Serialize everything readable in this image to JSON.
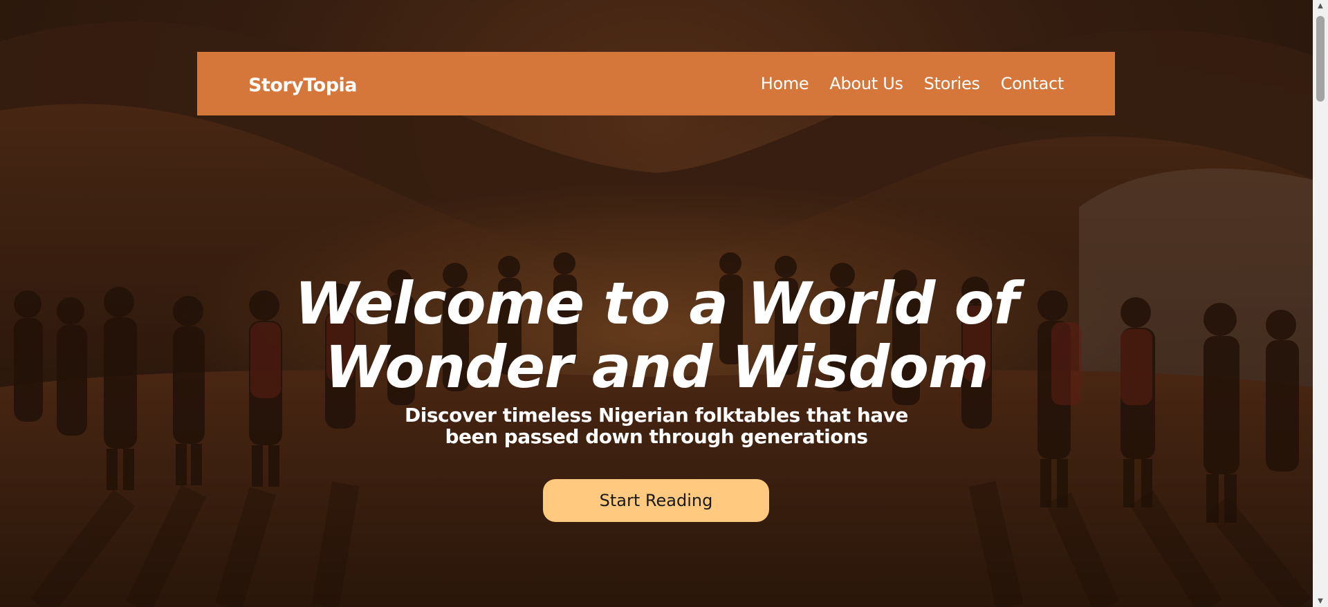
{
  "navbar": {
    "brand": "StoryTopia",
    "links": [
      {
        "label": "Home"
      },
      {
        "label": "About Us"
      },
      {
        "label": "Stories"
      },
      {
        "label": "Contact"
      }
    ],
    "background_color": "#d5773b"
  },
  "hero": {
    "headline_lines": [
      "Welcome to a World of",
      "Wonder and Wisdom"
    ],
    "subhead_lines": [
      "Discover timeless Nigerian folktables that have",
      "been passed down through generations"
    ],
    "cta_label": "Start Reading",
    "cta_color": "#ffca80"
  },
  "scrollbar": {
    "up_icon": "scroll-up-arrow",
    "down_icon": "scroll-down-arrow"
  }
}
